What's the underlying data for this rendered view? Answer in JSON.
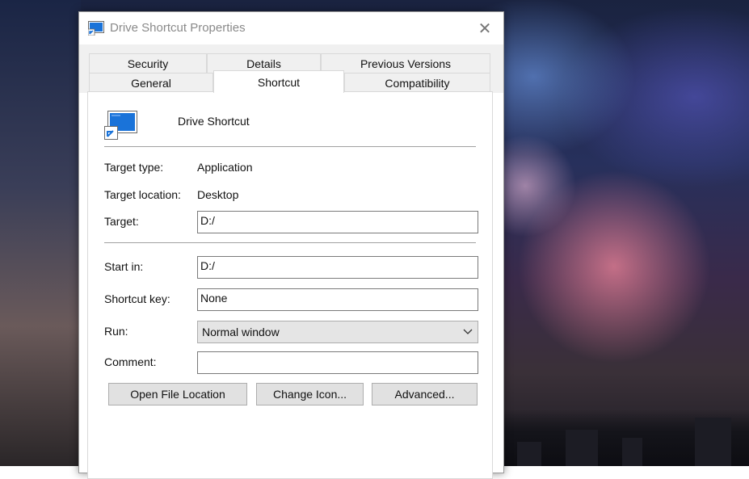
{
  "window": {
    "title": "Drive Shortcut Properties",
    "close_glyph": "✕"
  },
  "tabs": {
    "row1": [
      "Security",
      "Details",
      "Previous Versions"
    ],
    "row2": [
      "General",
      "Shortcut",
      "Compatibility"
    ],
    "active": "Shortcut"
  },
  "shortcut": {
    "name": "Drive Shortcut",
    "fields": {
      "target_type_label": "Target type:",
      "target_type_value": "Application",
      "target_location_label": "Target location:",
      "target_location_value": "Desktop",
      "target_label": "Target:",
      "target_value": "D:/",
      "start_in_label": "Start in:",
      "start_in_value": "D:/",
      "shortcut_key_label": "Shortcut key:",
      "shortcut_key_value": "None",
      "run_label": "Run:",
      "run_value": "Normal window",
      "comment_label": "Comment:",
      "comment_value": ""
    },
    "buttons": {
      "open_file_location": "Open File Location",
      "change_icon": "Change Icon...",
      "advanced": "Advanced..."
    }
  },
  "icons": {
    "title_icon": "shortcut-app-icon",
    "big_icon": "shortcut-app-icon",
    "close": "close-icon",
    "dropdown": "chevron-down-icon"
  },
  "colors": {
    "accent_blue": "#1a73d9",
    "window_bg": "#ffffff",
    "tab_bg": "#f0f0f0",
    "button_bg": "#e1e1e1"
  }
}
